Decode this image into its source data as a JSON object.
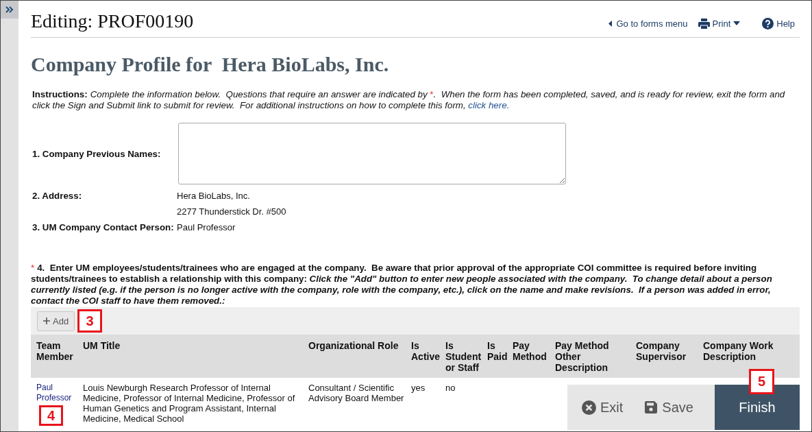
{
  "sidebar": {
    "expanded": false
  },
  "header": {
    "title": "Editing: PROF00190",
    "links": [
      {
        "kind": "back",
        "label": "Go to forms menu"
      },
      {
        "kind": "print",
        "label": "Print"
      },
      {
        "kind": "help",
        "label": "Help"
      }
    ]
  },
  "page_title": "Company Profile for  Hera BioLabs, Inc.",
  "instructions": [
    {
      "kind": "label",
      "text": "Instructions:"
    },
    {
      "kind": "text",
      "text": "Complete the information below.  Questions that require an answer are indicated by "
    },
    {
      "kind": "required",
      "text": "*"
    },
    {
      "kind": "text",
      "text": ".  When the form has been completed, saved, and is ready for review, exit the form and click the Sign and Submit link to submit for review.  For additional instructions on how to complete this form, "
    },
    {
      "kind": "link",
      "text": "click here."
    }
  ],
  "fields": [
    {
      "kind": "textarea",
      "label": "1. Company Previous Names:"
    },
    {
      "kind": "lines",
      "label": "2. Address:",
      "lines": [
        "Hera BioLabs, Inc.",
        "2277 Thunderstick Dr. #500"
      ]
    },
    {
      "kind": "lines",
      "label": "3. UM Company Contact Person:",
      "lines": [
        "Paul Professor"
      ]
    }
  ],
  "question": {
    "required_mark": "*",
    "text": "4.  Enter UM employees/students/trainees who are engaged at the company.  Be aware that prior approval of the appropriate COI committee is required before inviting students/trainees to establish a relationship with this company: *Click the \"Add\" button to enter new people associated with the company.  To change detail about a person currently listed (e.g. if the person is no longer active with the company, role with the company, etc.), click on the name and make revisions.  If a person was added in error, contact the COI staff to have them removed.:*"
  },
  "toolbar": {
    "add_button": "Add",
    "callout": "3"
  },
  "table": {
    "columns": [
      "Team Member",
      "UM Title",
      "Organizational Role",
      "Is Active",
      "Is Student or Staff",
      "Is Paid",
      "Pay Method",
      "Pay Method Other Description",
      "Company Supervisor",
      "Company Work Description"
    ],
    "rows": [
      {
        "cells": [
          "Paul Professor",
          "Louis Newburgh Research Professor of Internal Medicine, Professor of Internal Medicine, Professor of Human Genetics and Program Assistant, Internal Medicine, Medical School",
          "Consultant / Scientific Advisory Board Member",
          "yes",
          "no"
        ],
        "callout": "4"
      }
    ]
  },
  "footer": {
    "buttons": [
      {
        "kind": "exit",
        "label": "Exit"
      },
      {
        "kind": "save",
        "label": "Save"
      },
      {
        "kind": "finish",
        "label": "Finish"
      }
    ],
    "callout": "5"
  }
}
